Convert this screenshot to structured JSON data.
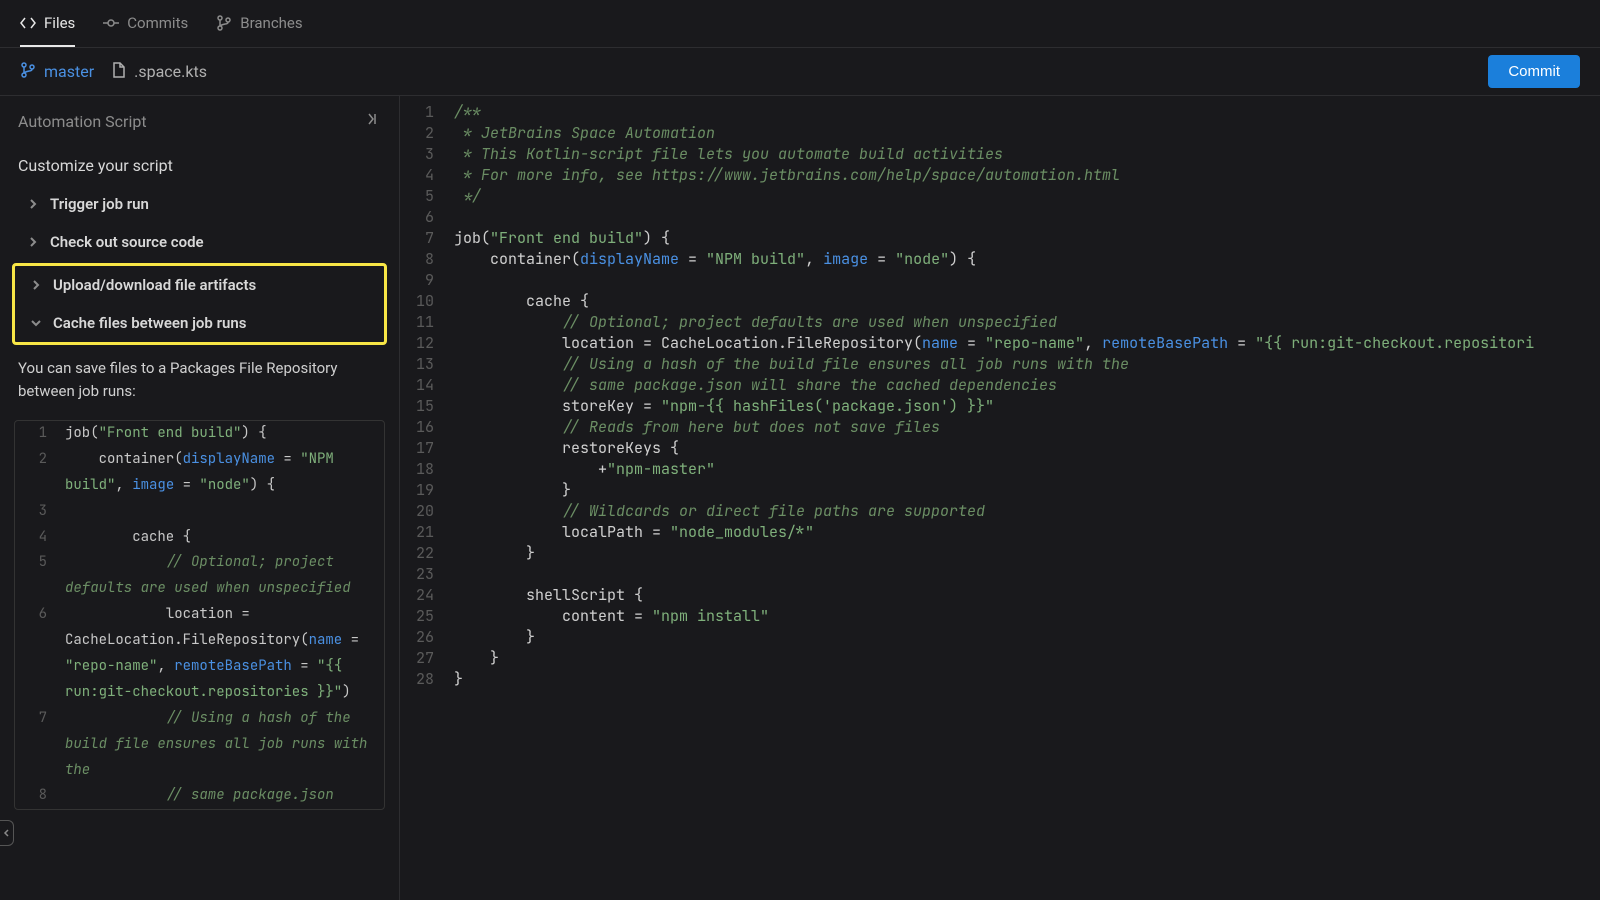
{
  "topTabs": {
    "files": "Files",
    "commits": "Commits",
    "branches": "Branches"
  },
  "breadcrumb": {
    "branch": "master",
    "filename": ".space.kts"
  },
  "commitButton": "Commit",
  "sidebar": {
    "header": "Automation Script",
    "subtitle": "Customize your script",
    "items": {
      "trigger": "Trigger job run",
      "checkout": "Check out source code",
      "artifacts": "Upload/download file artifacts",
      "cache": "Cache files between job runs"
    },
    "description": "You can save files to a Packages File Repository between job runs:",
    "snippet": [
      {
        "ln": "1",
        "segs": [
          {
            "t": "job(",
            "c": ""
          },
          {
            "t": "\"Front end build\"",
            "c": "tok-str"
          },
          {
            "t": ") {",
            "c": ""
          }
        ]
      },
      {
        "ln": "2",
        "segs": [
          {
            "t": "    container(",
            "c": ""
          },
          {
            "t": "displayName",
            "c": "tok-arg"
          },
          {
            "t": " = ",
            "c": ""
          },
          {
            "t": "\"NPM build\"",
            "c": "tok-str"
          },
          {
            "t": ", ",
            "c": ""
          },
          {
            "t": "image",
            "c": "tok-arg"
          },
          {
            "t": " = ",
            "c": ""
          },
          {
            "t": "\"node\"",
            "c": "tok-str"
          },
          {
            "t": ") {",
            "c": ""
          }
        ]
      },
      {
        "ln": "3",
        "segs": []
      },
      {
        "ln": "4",
        "segs": [
          {
            "t": "        cache {",
            "c": ""
          }
        ]
      },
      {
        "ln": "5",
        "segs": [
          {
            "t": "            // Optional; project defaults are used when unspecified",
            "c": "tok-comment"
          }
        ]
      },
      {
        "ln": "6",
        "segs": [
          {
            "t": "            location = CacheLocation.FileRepository(",
            "c": ""
          },
          {
            "t": "name",
            "c": "tok-arg"
          },
          {
            "t": " = ",
            "c": ""
          },
          {
            "t": "\"repo-name\"",
            "c": "tok-str"
          },
          {
            "t": ", ",
            "c": ""
          },
          {
            "t": "remoteBasePath",
            "c": "tok-arg"
          },
          {
            "t": " = ",
            "c": ""
          },
          {
            "t": "\"{{ run:git-checkout.repositories }}\"",
            "c": "tok-str"
          },
          {
            "t": ")",
            "c": ""
          }
        ]
      },
      {
        "ln": "7",
        "segs": [
          {
            "t": "            // Using a hash of the build file ensures all job runs with the",
            "c": "tok-comment"
          }
        ]
      },
      {
        "ln": "8",
        "segs": [
          {
            "t": "            // same package.json",
            "c": "tok-comment"
          }
        ]
      }
    ]
  },
  "editor": [
    {
      "ln": "1",
      "segs": [
        {
          "t": "/**",
          "c": "tok-comment"
        }
      ]
    },
    {
      "ln": "2",
      "segs": [
        {
          "t": " * JetBrains Space Automation",
          "c": "tok-comment"
        }
      ]
    },
    {
      "ln": "3",
      "segs": [
        {
          "t": " * This Kotlin-script file lets you automate build activities",
          "c": "tok-comment"
        }
      ]
    },
    {
      "ln": "4",
      "segs": [
        {
          "t": " * For more info, see https://www.jetbrains.com/help/space/automation.html",
          "c": "tok-comment"
        }
      ]
    },
    {
      "ln": "5",
      "segs": [
        {
          "t": " */",
          "c": "tok-comment"
        }
      ]
    },
    {
      "ln": "6",
      "segs": []
    },
    {
      "ln": "7",
      "segs": [
        {
          "t": "job(",
          "c": "tok-fn"
        },
        {
          "t": "\"Front end build\"",
          "c": "tok-str"
        },
        {
          "t": ") {",
          "c": ""
        }
      ]
    },
    {
      "ln": "8",
      "segs": [
        {
          "t": "    container(",
          "c": ""
        },
        {
          "t": "displayName",
          "c": "tok-arg"
        },
        {
          "t": " = ",
          "c": ""
        },
        {
          "t": "\"NPM build\"",
          "c": "tok-str"
        },
        {
          "t": ", ",
          "c": ""
        },
        {
          "t": "image",
          "c": "tok-arg"
        },
        {
          "t": " = ",
          "c": ""
        },
        {
          "t": "\"node\"",
          "c": "tok-str"
        },
        {
          "t": ") {",
          "c": ""
        }
      ]
    },
    {
      "ln": "9",
      "segs": []
    },
    {
      "ln": "10",
      "segs": [
        {
          "t": "        cache {",
          "c": ""
        }
      ]
    },
    {
      "ln": "11",
      "segs": [
        {
          "t": "            // Optional; project defaults are used when unspecified",
          "c": "tok-comment"
        }
      ]
    },
    {
      "ln": "12",
      "segs": [
        {
          "t": "            location = CacheLocation.FileRepository(",
          "c": ""
        },
        {
          "t": "name",
          "c": "tok-arg"
        },
        {
          "t": " = ",
          "c": ""
        },
        {
          "t": "\"repo-name\"",
          "c": "tok-str"
        },
        {
          "t": ", ",
          "c": ""
        },
        {
          "t": "remoteBasePath",
          "c": "tok-arg"
        },
        {
          "t": " = ",
          "c": ""
        },
        {
          "t": "\"{{ run:git-checkout.repositori",
          "c": "tok-str"
        }
      ]
    },
    {
      "ln": "13",
      "segs": [
        {
          "t": "            // Using a hash of the build file ensures all job runs with the",
          "c": "tok-comment"
        }
      ]
    },
    {
      "ln": "14",
      "segs": [
        {
          "t": "            // same package.json will share the cached dependencies",
          "c": "tok-comment"
        }
      ]
    },
    {
      "ln": "15",
      "segs": [
        {
          "t": "            storeKey = ",
          "c": ""
        },
        {
          "t": "\"npm-{{ hashFiles('package.json') }}\"",
          "c": "tok-str"
        }
      ]
    },
    {
      "ln": "16",
      "segs": [
        {
          "t": "            // Reads from here but does not save files",
          "c": "tok-comment"
        }
      ]
    },
    {
      "ln": "17",
      "segs": [
        {
          "t": "            restoreKeys {",
          "c": ""
        }
      ]
    },
    {
      "ln": "18",
      "segs": [
        {
          "t": "                +",
          "c": ""
        },
        {
          "t": "\"npm-master\"",
          "c": "tok-str"
        }
      ]
    },
    {
      "ln": "19",
      "segs": [
        {
          "t": "            }",
          "c": ""
        }
      ]
    },
    {
      "ln": "20",
      "segs": [
        {
          "t": "            // Wildcards or direct file paths are supported",
          "c": "tok-comment"
        }
      ]
    },
    {
      "ln": "21",
      "segs": [
        {
          "t": "            localPath = ",
          "c": ""
        },
        {
          "t": "\"node_modules/*\"",
          "c": "tok-str"
        }
      ]
    },
    {
      "ln": "22",
      "segs": [
        {
          "t": "        }",
          "c": ""
        }
      ]
    },
    {
      "ln": "23",
      "segs": []
    },
    {
      "ln": "24",
      "segs": [
        {
          "t": "        shellScript {",
          "c": ""
        }
      ]
    },
    {
      "ln": "25",
      "segs": [
        {
          "t": "            content = ",
          "c": ""
        },
        {
          "t": "\"npm install\"",
          "c": "tok-str"
        }
      ]
    },
    {
      "ln": "26",
      "segs": [
        {
          "t": "        }",
          "c": ""
        }
      ]
    },
    {
      "ln": "27",
      "segs": [
        {
          "t": "    }",
          "c": ""
        }
      ]
    },
    {
      "ln": "28",
      "segs": [
        {
          "t": "}",
          "c": ""
        }
      ]
    }
  ]
}
